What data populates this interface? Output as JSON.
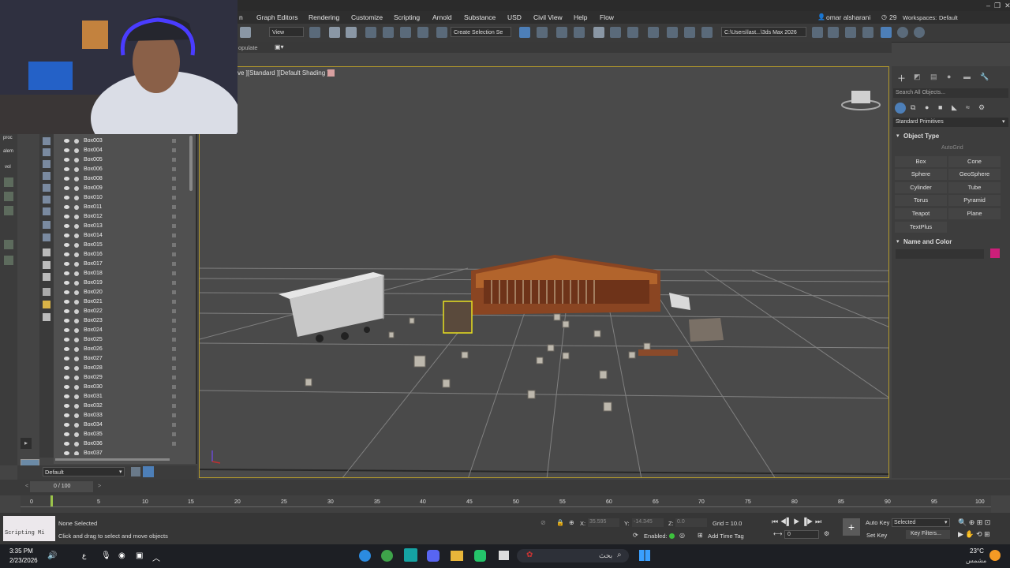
{
  "menu": [
    "n",
    "Graph Editors",
    "Rendering",
    "Customize",
    "Scripting",
    "Arnold",
    "Substance",
    "USD",
    "Civil View",
    "Help",
    "Flow"
  ],
  "user": {
    "name": "omar alsharani",
    "notifications": "29"
  },
  "workspace": {
    "label": "Workspaces:",
    "value": "Default"
  },
  "toolbar": {
    "view_dropdown": "View",
    "selection_set": "Create Selection Se",
    "project_path": "C:\\Users\\last...\\3ds Max 2026",
    "sub_label": "opulate"
  },
  "viewport": {
    "label": "ve ][Standard ][Default Shading ]"
  },
  "scene_explorer": {
    "items": [
      "Box003",
      "Box004",
      "Box005",
      "Box006",
      "Box008",
      "Box009",
      "Box010",
      "Box011",
      "Box012",
      "Box013",
      "Box014",
      "Box015",
      "Box016",
      "Box017",
      "Box018",
      "Box019",
      "Box020",
      "Box021",
      "Box022",
      "Box023",
      "Box024",
      "Box025",
      "Box026",
      "Box027",
      "Box028",
      "Box029",
      "Box030",
      "Box031",
      "Box032",
      "Box033",
      "Box034",
      "Box035",
      "Box036",
      "Box037"
    ],
    "layer": "Default"
  },
  "left_strip_labels": [
    "proc",
    "alem",
    "vol"
  ],
  "command_panel": {
    "search_placeholder": "Search All Objects...",
    "category": "Standard Primitives",
    "object_type_title": "Object Type",
    "autogrid": "AutoGrid",
    "buttons": [
      "Box",
      "Cone",
      "Sphere",
      "GeoSphere",
      "Cylinder",
      "Tube",
      "Torus",
      "Pyramid",
      "Teapot",
      "Plane",
      "TextPlus"
    ],
    "name_color_title": "Name and Color",
    "swatch_color": "#cc1f7a"
  },
  "timeline": {
    "frame_counter": "0 / 100",
    "ticks": [
      "0",
      "5",
      "10",
      "15",
      "20",
      "25",
      "30",
      "35",
      "40",
      "45",
      "50",
      "55",
      "60",
      "65",
      "70",
      "75",
      "80",
      "85",
      "90",
      "95",
      "100"
    ]
  },
  "status": {
    "maxscript": "Scripting Mi",
    "selection": "None Selected",
    "prompt": "Click and drag to select and move objects",
    "x_label": "X:",
    "x_value": "35.595",
    "y_label": "Y:",
    "y_value": "-14.345",
    "z_label": "Z:",
    "z_value": "0.0",
    "grid": "Grid = 10.0",
    "enabled": "Enabled:",
    "add_time_tag": "Add Time Tag",
    "auto_key": "Auto Key",
    "set_key": "Set Key",
    "selected": "Selected",
    "key_filters": "Key Filters...",
    "frame": "0"
  },
  "taskbar": {
    "time": "3:35 PM",
    "date": "2/23/2026",
    "lang": "ع",
    "search": "بحث",
    "weather_temp": "23°C",
    "weather_desc": "مشمس"
  }
}
